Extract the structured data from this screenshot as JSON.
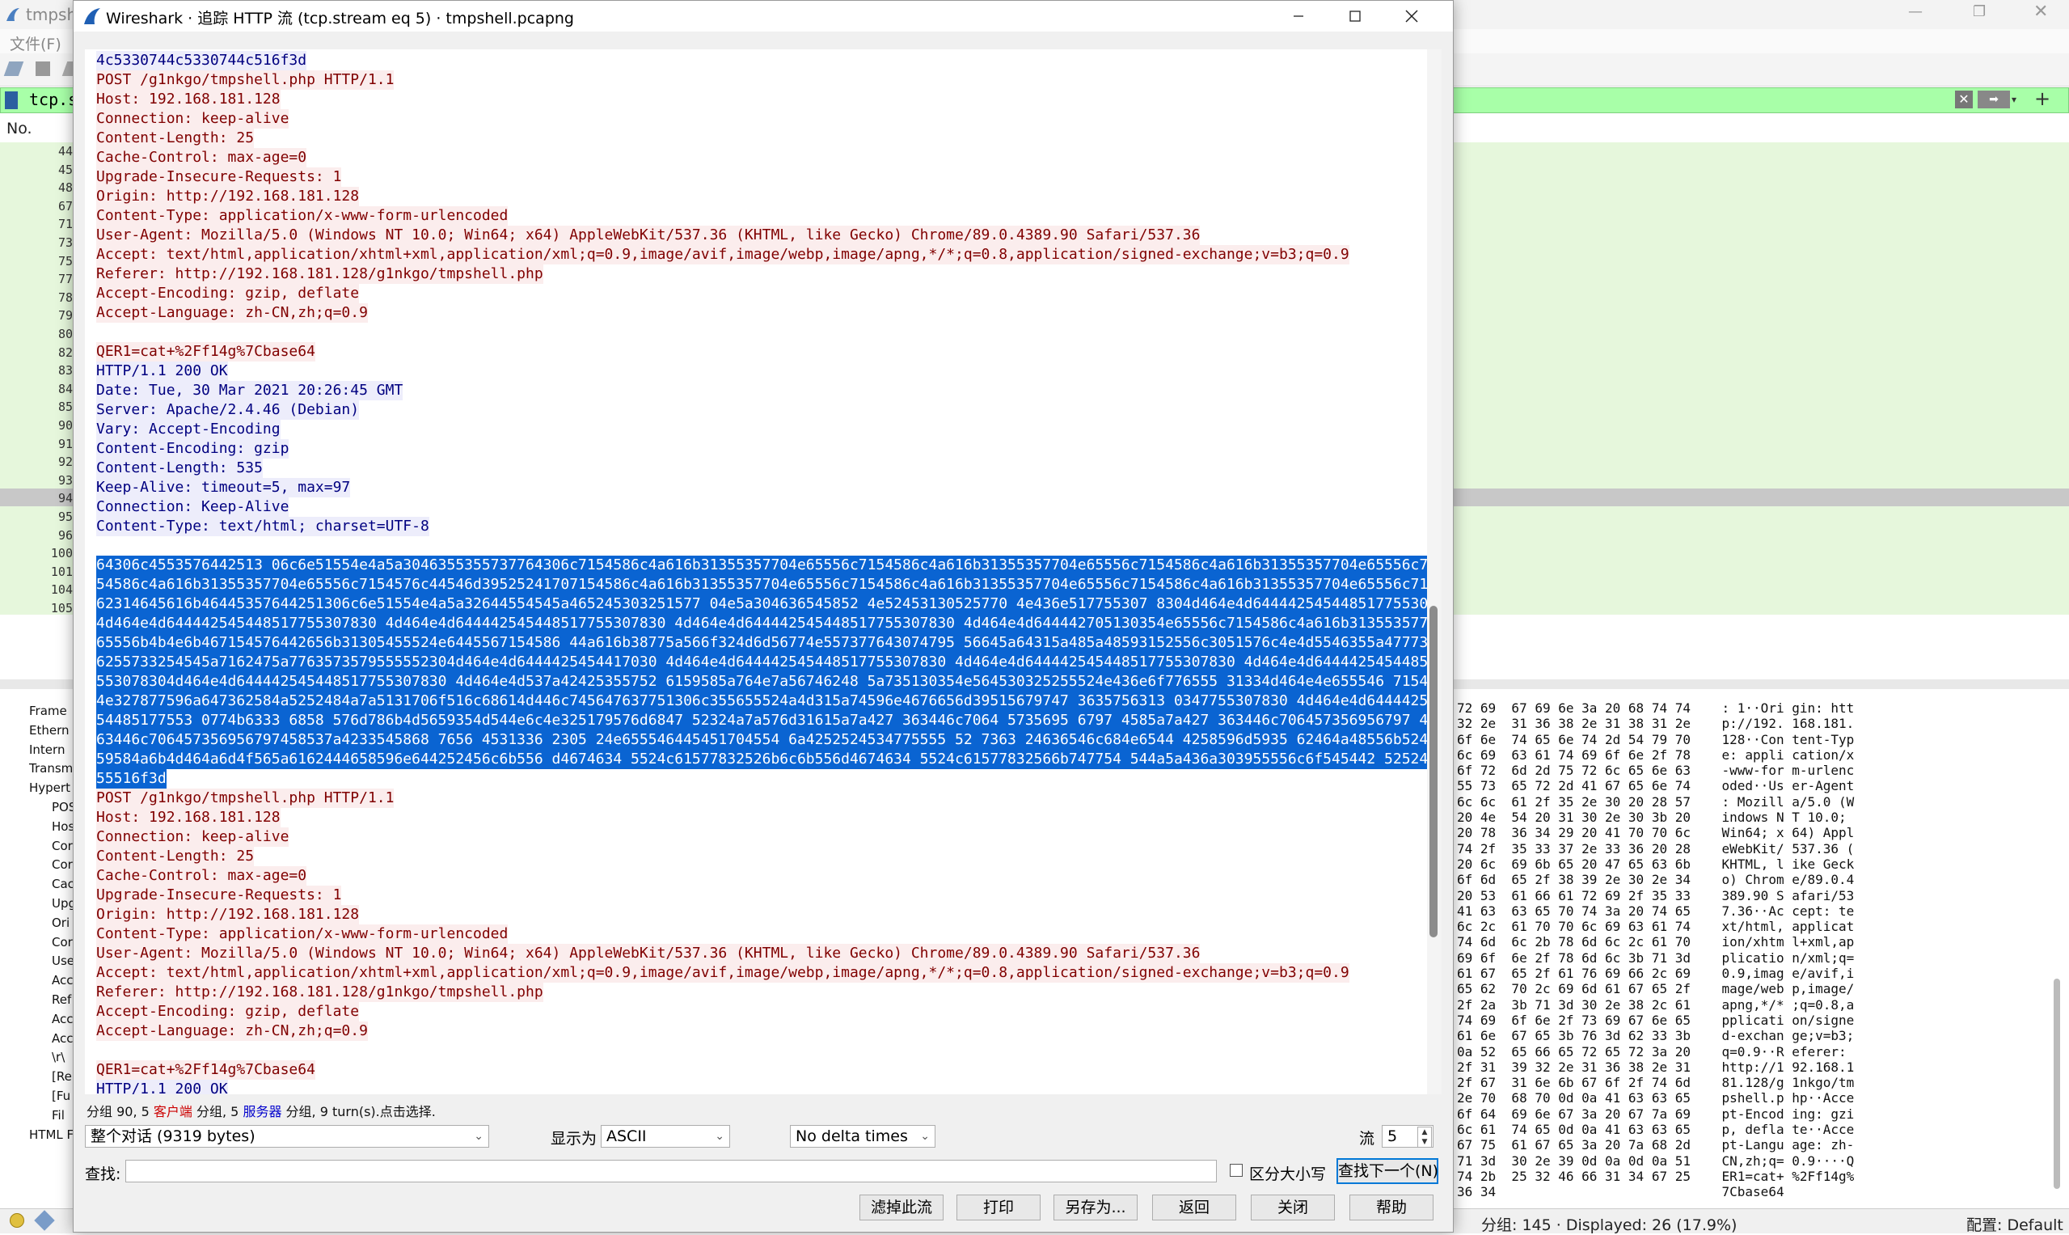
{
  "background": {
    "title": "tmpshe",
    "menu_file": "文件(F)",
    "filter_text": "tcp.str",
    "col_no": "No.",
    "row_numbers": [
      "44",
      "45",
      "48",
      "67",
      "71",
      "73",
      "75",
      "77",
      "78",
      "79",
      "80",
      "82",
      "83",
      "84",
      "85",
      "90",
      "91",
      "92",
      "93",
      "94",
      "95",
      "96",
      "100",
      "101",
      "104",
      "105"
    ],
    "tree": [
      "Frame",
      "Ethern",
      "Intern",
      "Transm",
      "Hypert",
      "POS",
      "Hos",
      "Cor",
      "Cor",
      "Cac",
      "Upg",
      "Ori",
      "Cor",
      "Use",
      "Acc",
      "Ref",
      "Acc",
      "Acc",
      "\\r\\",
      "[Re",
      "[Fu",
      "Fil",
      "HTML F"
    ],
    "hex_lines": [
      "72 69  67 69 6e 3a 20 68 74 74    : 1··Ori gin: htt",
      "32 2e  31 36 38 2e 31 38 31 2e    p://192. 168.181.",
      "6f 6e  74 65 6e 74 2d 54 79 70    128··Con tent-Typ",
      "6c 69  63 61 74 69 6f 6e 2f 78    e: appli cation/x",
      "6f 72  6d 2d 75 72 6c 65 6e 63    -www-for m-urlenc",
      "55 73  65 72 2d 41 67 65 6e 74    oded··Us er-Agent",
      "6c 6c  61 2f 35 2e 30 20 28 57    : Mozill a/5.0 (W",
      "20 4e  54 20 31 30 2e 30 3b 20    indows N T 10.0; ",
      "20 78  36 34 29 20 41 70 70 6c    Win64; x 64) Appl",
      "74 2f  35 33 37 2e 33 36 20 28    eWebKit/ 537.36 (",
      "20 6c  69 6b 65 20 47 65 63 6b    KHTML, l ike Geck",
      "6f 6d  65 2f 38 39 2e 30 2e 34    o) Chrom e/89.0.4",
      "20 53  61 66 61 72 69 2f 35 33    389.90 S afari/53",
      "41 63  63 65 70 74 3a 20 74 65    7.36··Ac cept: te",
      "6c 2c  61 70 70 6c 69 63 61 74    xt/html, applicat",
      "74 6d  6c 2b 78 6d 6c 2c 61 70    ion/xhtm l+xml,ap",
      "69 6f  6e 2f 78 6d 6c 3b 71 3d    plicatio n/xml;q=",
      "61 67  65 2f 61 76 69 66 2c 69    0.9,imag e/avif,i",
      "65 62  70 2c 69 6d 61 67 65 2f    mage/web p,image/",
      "2f 2a  3b 71 3d 30 2e 38 2c 61    apng,*/* ;q=0.8,a",
      "74 69  6f 6e 2f 73 69 67 6e 65    pplicati on/signe",
      "61 6e  67 65 3b 76 3d 62 33 3b    d-exchan ge;v=b3;",
      "0a 52  65 66 65 72 65 72 3a 20    q=0.9··R eferer: ",
      "2f 31  39 32 2e 31 36 38 2e 31    http://1 92.168.1",
      "2f 67  31 6e 6b 67 6f 2f 74 6d    81.128/g 1nkgo/tm",
      "2e 70  68 70 0d 0a 41 63 63 65    pshell.p hp··Acce",
      "6f 64  69 6e 67 3a 20 67 7a 69    pt-Encod ing: gzi",
      "6c 61  74 65 0d 0a 41 63 63 65    p, defla te··Acce",
      "67 75  61 67 65 3a 20 7a 68 2d    pt-Langu age: zh-",
      "71 3d  30 2e 39 0d 0a 0d 0a 51    CN,zh;q= 0.9····Q",
      "74 2b  25 32 46 66 31 34 67 25    ER1=cat+ %2Ff14g%",
      "36 34                             7Cbase64"
    ],
    "status_left": "分组: 145 · Displayed: 26 (17.9%)",
    "status_right": "配置: Default"
  },
  "dialog": {
    "title": "Wireshark · 追踪 HTTP 流 (tcp.stream eq 5) · tmpshell.pcapng",
    "stream_lines": [
      {
        "t": "4c5330744c5330744c516f3d",
        "k": "sv"
      },
      {
        "t": "POST /g1nkgo/tmpshell.php HTTP/1.1",
        "k": "cl"
      },
      {
        "t": "Host: 192.168.181.128",
        "k": "cl"
      },
      {
        "t": "Connection: keep-alive",
        "k": "cl"
      },
      {
        "t": "Content-Length: 25",
        "k": "cl"
      },
      {
        "t": "Cache-Control: max-age=0",
        "k": "cl"
      },
      {
        "t": "Upgrade-Insecure-Requests: 1",
        "k": "cl"
      },
      {
        "t": "Origin: http://192.168.181.128",
        "k": "cl"
      },
      {
        "t": "Content-Type: application/x-www-form-urlencoded",
        "k": "cl"
      },
      {
        "t": "User-Agent: Mozilla/5.0 (Windows NT 10.0; Win64; x64) AppleWebKit/537.36 (KHTML, like Gecko) Chrome/89.0.4389.90 Safari/537.36",
        "k": "cl"
      },
      {
        "t": "Accept: text/html,application/xhtml+xml,application/xml;q=0.9,image/avif,image/webp,image/apng,*/*;q=0.8,application/signed-exchange;v=b3;q=0.9",
        "k": "cl"
      },
      {
        "t": "Referer: http://192.168.181.128/g1nkgo/tmpshell.php",
        "k": "cl"
      },
      {
        "t": "Accept-Encoding: gzip, deflate",
        "k": "cl"
      },
      {
        "t": "Accept-Language: zh-CN,zh;q=0.9",
        "k": "cl"
      },
      {
        "t": "",
        "k": "cl"
      },
      {
        "t": "QER1=cat+%2Ff14g%7Cbase64",
        "k": "cl"
      },
      {
        "t": "HTTP/1.1 200 OK",
        "k": "sv"
      },
      {
        "t": "Date: Tue, 30 Mar 2021 20:26:45 GMT",
        "k": "sv"
      },
      {
        "t": "Server: Apache/2.4.46 (Debian)",
        "k": "sv"
      },
      {
        "t": "Vary: Accept-Encoding",
        "k": "sv"
      },
      {
        "t": "Content-Encoding: gzip",
        "k": "sv"
      },
      {
        "t": "Content-Length: 535",
        "k": "sv"
      },
      {
        "t": "Keep-Alive: timeout=5, max=97",
        "k": "sv"
      },
      {
        "t": "Connection: Keep-Alive",
        "k": "sv"
      },
      {
        "t": "Content-Type: text/html; charset=UTF-8",
        "k": "sv"
      },
      {
        "t": "",
        "k": "sv"
      },
      {
        "t": "64306c4553576442513 06c6e51554e4a5a3046355355737764306c7154586c4a616b31355357704e65556c7154586c4a616b31355357704e65556c7154586c4a616b31355357704e65556c71",
        "k": "hl"
      },
      {
        "t": "54586c4a616b31355357704e65556c7154576c44546d39525241707154586c4a616b31355357704e65556c7154586c4a616b31355357704e65556c7154586c4a616b31355357704e65556c71",
        "k": "hl"
      },
      {
        "t": "62314645616b46445357644251306c6e51554e4a5a32644554545a465245303251577 04e5a304636545852 4e52453130525770 4e436e517755307 8304d464e4d64444254544851775530783 0",
        "k": "hl"
      },
      {
        "t": "4d464e4d644442545448517755307830 4d464e4d644442545448517755307830 4d464e4d644442545448517755307830 4d464e4d644442705130354e65556c7154586c4a616b31355357704e",
        "k": "hl"
      },
      {
        "t": "65556b4b4e6b467154576442656b31305455524e6445567154586 44a616b38775a566f324d6d56774e557377643074795 56645a64315a485a48593152556c3051576c4e4d5546355a477731",
        "k": "hl"
      },
      {
        "t": "6255733254545a7162475a7763573579555552304d464e4d6444425454417030 4d464e4d644442545448517755307830 4d464e4d644442545448517755307830 4d464e4d6444425454485177",
        "k": "hl"
      },
      {
        "t": "553078304d464e4d644442545448517755307830 4d464e4d537a42425355752 6159585a764e7a56746248 5a735130354e564530325255524e436e6f776555 31334d464e4e655546 7154545a52",
        "k": "hl"
      },
      {
        "t": "4e327877596a647362584a5252484a7a5131706f516c68614d446c745647637751306c355655524a4d315a74596e4676656d39515679747 3635756313 0347755307830 4d464e4d64444254",
        "k": "hl"
      },
      {
        "t": "54485177553 0774b6333 6858 576d786b4d5659354d544e6c4e325179576d6847 52324a7a576d31615a7a427 363446c7064 5735695 6797 4585a7a427 363446c706457356956797 4585a7a4273",
        "k": "hl"
      },
      {
        "t": "63446c706457356956797458537a4233545868 7656 4531336 2305 24e655546445451704554 6a4252524534775555 52 7363 24636546c684e6544 4258596d5935 62464a48556b524f52453477",
        "k": "hl"
      },
      {
        "t": "59584a6b4d464a6d4f565a6162444658596e644252456c6b556 d4674634 5524c61577832526b6c6b556d4674634 5524c61577832566b747754 544a5a436a303955556c6f545442 5252453477",
        "k": "hl"
      },
      {
        "t": "55516f3d",
        "k": "hl"
      },
      {
        "t": "POST /g1nkgo/tmpshell.php HTTP/1.1",
        "k": "cl"
      },
      {
        "t": "Host: 192.168.181.128",
        "k": "cl"
      },
      {
        "t": "Connection: keep-alive",
        "k": "cl"
      },
      {
        "t": "Content-Length: 25",
        "k": "cl"
      },
      {
        "t": "Cache-Control: max-age=0",
        "k": "cl"
      },
      {
        "t": "Upgrade-Insecure-Requests: 1",
        "k": "cl"
      },
      {
        "t": "Origin: http://192.168.181.128",
        "k": "cl"
      },
      {
        "t": "Content-Type: application/x-www-form-urlencoded",
        "k": "cl"
      },
      {
        "t": "User-Agent: Mozilla/5.0 (Windows NT 10.0; Win64; x64) AppleWebKit/537.36 (KHTML, like Gecko) Chrome/89.0.4389.90 Safari/537.36",
        "k": "cl"
      },
      {
        "t": "Accept: text/html,application/xhtml+xml,application/xml;q=0.9,image/avif,image/webp,image/apng,*/*;q=0.8,application/signed-exchange;v=b3;q=0.9",
        "k": "cl"
      },
      {
        "t": "Referer: http://192.168.181.128/g1nkgo/tmpshell.php",
        "k": "cl"
      },
      {
        "t": "Accept-Encoding: gzip, deflate",
        "k": "cl"
      },
      {
        "t": "Accept-Language: zh-CN,zh;q=0.9",
        "k": "cl"
      },
      {
        "t": "",
        "k": "cl"
      },
      {
        "t": "QER1=cat+%2Ff14g%7Cbase64",
        "k": "cl"
      },
      {
        "t": "HTTP/1.1 200 OK",
        "k": "sv"
      }
    ],
    "summary_prefix": "分组 90, 5 ",
    "summary_client": "客户端",
    "summary_mid": " 分组, 5 ",
    "summary_server": "服务器",
    "summary_suffix": " 分组, 9 turn(s).点击选择.",
    "conversation_select": "整个对话 (9319 bytes)",
    "show_as_label": "显示为",
    "show_as_select": "ASCII",
    "delta_select": "No delta times",
    "stream_label": "流",
    "stream_value": "5",
    "find_label": "查找:",
    "find_value": "",
    "case_label": "区分大小写",
    "find_next_button": "查找下一个(N)",
    "buttons": {
      "filter_out": "滤掉此流",
      "print": "打印",
      "save_as": "另存为...",
      "back": "返回",
      "close": "关闭",
      "help": "帮助"
    },
    "colors": {
      "client_fg": "#800000",
      "client_bg": "#fbeded",
      "server_fg": "#000080",
      "server_bg": "#ededfb",
      "selection": "#0a64d2"
    }
  }
}
